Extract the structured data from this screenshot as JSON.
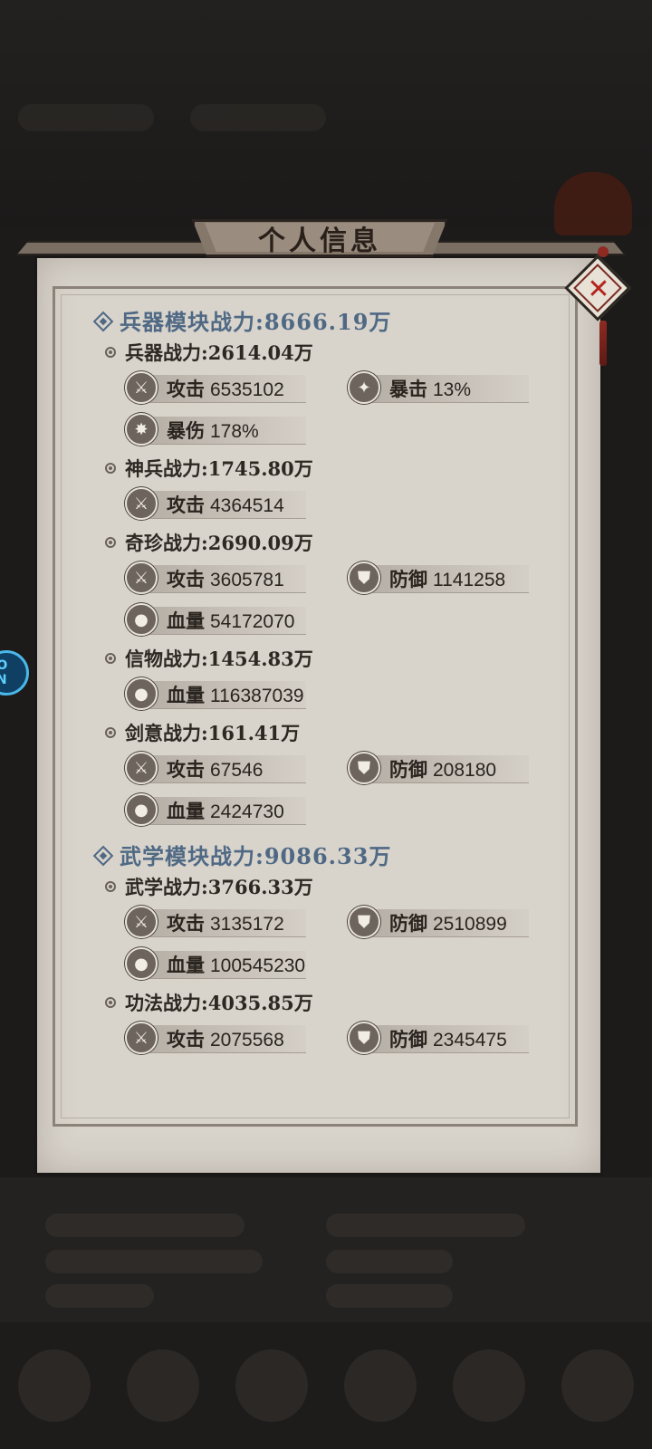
{
  "modal": {
    "title": "个人信息"
  },
  "sections": [
    {
      "title": "兵器模块战力:8666.19万",
      "subs": [
        {
          "title": "兵器战力:2614.04万",
          "stats": [
            {
              "icon": "crossed-swords-icon",
              "label": "攻击",
              "value": "6535102"
            },
            {
              "icon": "critical-strike-icon",
              "label": "暴击",
              "value": "13%"
            },
            {
              "icon": "critical-damage-icon",
              "label": "暴伤",
              "value": "178%"
            }
          ]
        },
        {
          "title": "神兵战力:1745.80万",
          "stats": [
            {
              "icon": "crossed-swords-icon",
              "label": "攻击",
              "value": "4364514"
            }
          ]
        },
        {
          "title": "奇珍战力:2690.09万",
          "stats": [
            {
              "icon": "crossed-swords-icon",
              "label": "攻击",
              "value": "3605781"
            },
            {
              "icon": "shield-icon",
              "label": "防御",
              "value": "1141258"
            },
            {
              "icon": "blood-drop-icon",
              "label": "血量",
              "value": "54172070"
            }
          ]
        },
        {
          "title": "信物战力:1454.83万",
          "stats": [
            {
              "icon": "blood-drop-icon",
              "label": "血量",
              "value": "116387039"
            }
          ]
        },
        {
          "title": "剑意战力:161.41万",
          "stats": [
            {
              "icon": "crossed-swords-icon",
              "label": "攻击",
              "value": "67546"
            },
            {
              "icon": "shield-icon",
              "label": "防御",
              "value": "208180"
            },
            {
              "icon": "blood-drop-icon",
              "label": "血量",
              "value": "2424730"
            }
          ]
        }
      ]
    },
    {
      "title": "武学模块战力:9086.33万",
      "subs": [
        {
          "title": "武学战力:3766.33万",
          "stats": [
            {
              "icon": "crossed-swords-icon",
              "label": "攻击",
              "value": "3135172"
            },
            {
              "icon": "shield-icon",
              "label": "防御",
              "value": "2510899"
            },
            {
              "icon": "blood-drop-icon",
              "label": "血量",
              "value": "100545230"
            }
          ]
        },
        {
          "title": "功法战力:4035.85万",
          "stats": [
            {
              "icon": "crossed-swords-icon",
              "label": "攻击",
              "value": "2075568"
            },
            {
              "icon": "shield-icon",
              "label": "防御",
              "value": "2345475"
            }
          ]
        }
      ]
    }
  ],
  "side_badge": "ÚO AN",
  "colors": {
    "section_title": "#4f6985",
    "panel": "#d8d3cb",
    "close_x": "#b3261e"
  }
}
